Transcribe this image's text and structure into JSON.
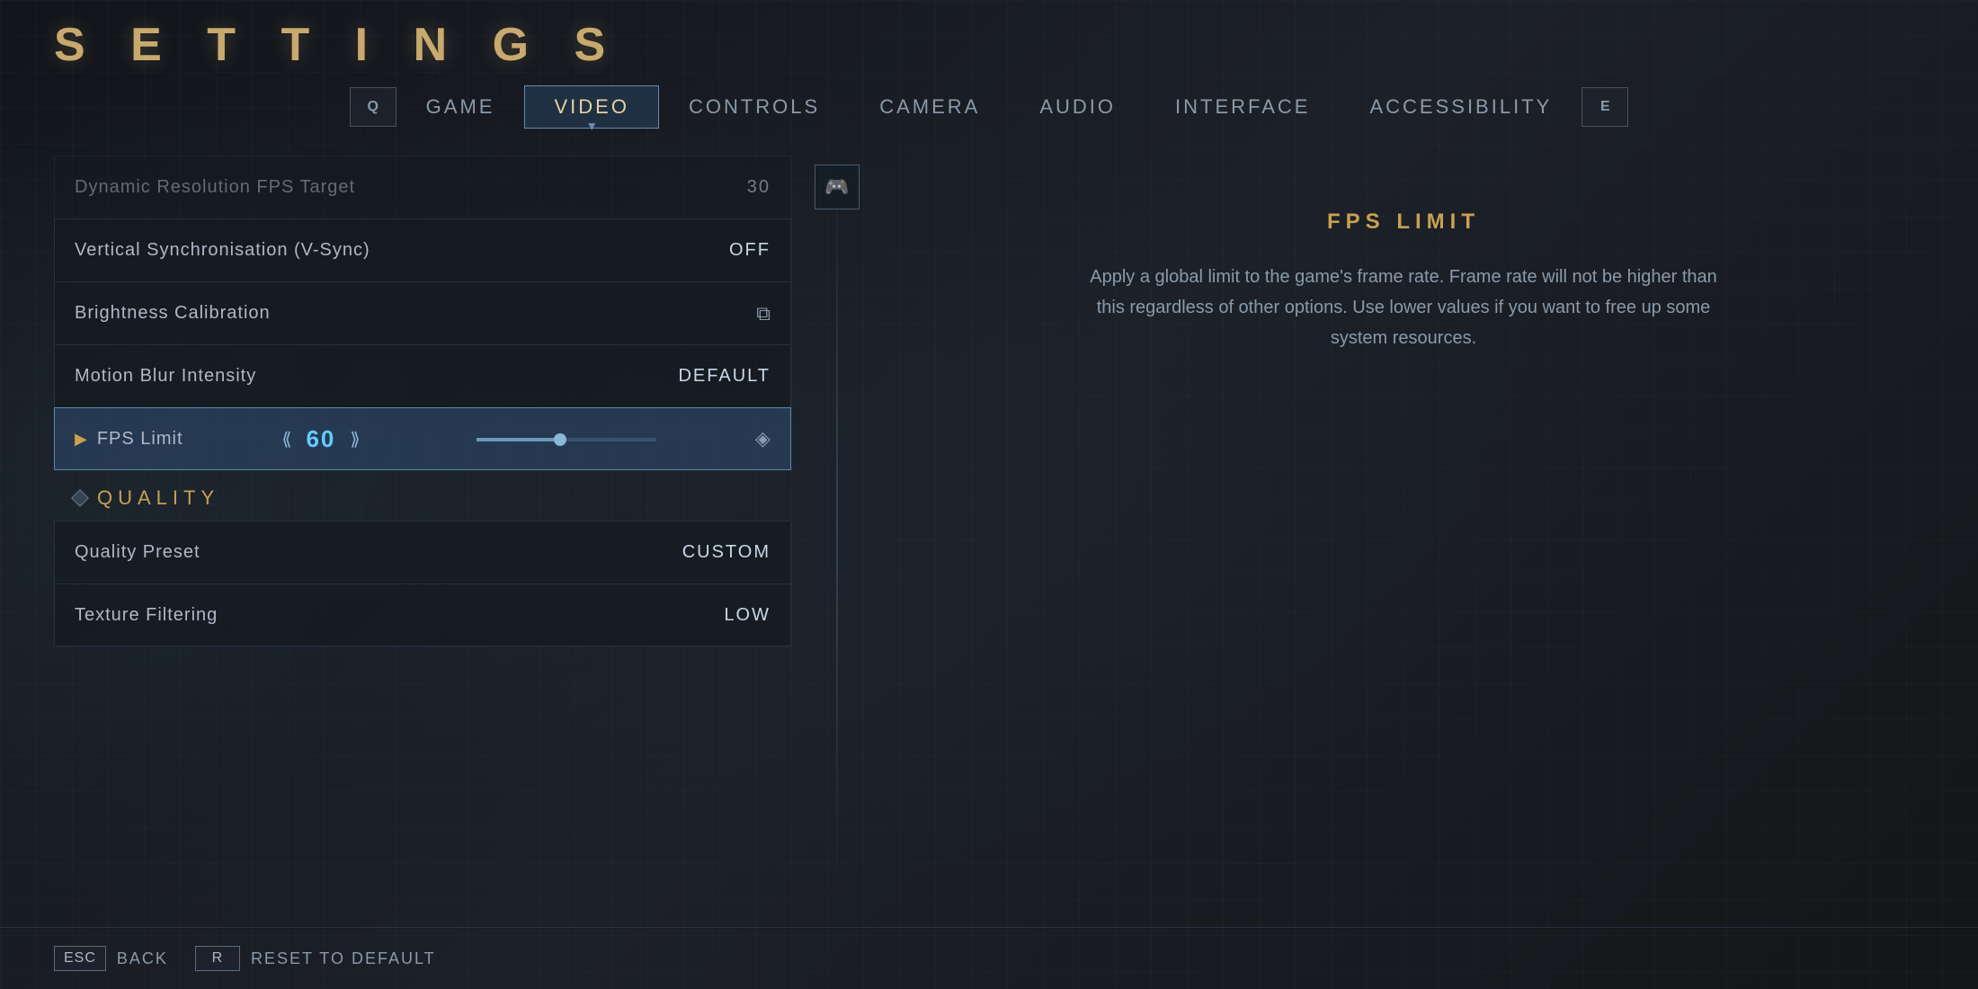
{
  "page": {
    "title": "S E T T I N G S"
  },
  "nav": {
    "left_icon": "Q",
    "right_icon": "E",
    "tabs": [
      {
        "id": "game",
        "label": "GAME",
        "active": false
      },
      {
        "id": "video",
        "label": "VIDEO",
        "active": true
      },
      {
        "id": "controls",
        "label": "CONTROLS",
        "active": false
      },
      {
        "id": "camera",
        "label": "CAMERA",
        "active": false
      },
      {
        "id": "audio",
        "label": "AUDIO",
        "active": false
      },
      {
        "id": "interface",
        "label": "INTERFACE",
        "active": false
      },
      {
        "id": "accessibility",
        "label": "ACCESSIBILITY",
        "active": false
      }
    ]
  },
  "settings": {
    "items": [
      {
        "id": "dynamic-resolution",
        "name": "Dynamic Resolution FPS Target",
        "value": "30",
        "dimmed": true
      },
      {
        "id": "vsync",
        "name": "Vertical Synchronisation (V-Sync)",
        "value": "OFF"
      },
      {
        "id": "brightness",
        "name": "Brightness Calibration",
        "value": "",
        "has_icon": true
      },
      {
        "id": "motion-blur",
        "name": "Motion Blur Intensity",
        "value": "DEFAULT"
      },
      {
        "id": "fps-limit",
        "name": "FPS Limit",
        "value": "60",
        "active": true,
        "has_slider": true
      }
    ],
    "quality_section": {
      "header": "QUALITY",
      "items": [
        {
          "id": "quality-preset",
          "name": "Quality Preset",
          "value": "CUSTOM"
        },
        {
          "id": "texture-filtering",
          "name": "Texture Filtering",
          "value": "LOW"
        }
      ]
    }
  },
  "info_panel": {
    "title": "FPS LIMIT",
    "description": "Apply a global limit to the game's frame rate. Frame rate will not be higher than this regardless of other options. Use lower values if you want to free up some system resources."
  },
  "bottom_bar": {
    "buttons": [
      {
        "key": "ESC",
        "label": "Back"
      },
      {
        "key": "R",
        "label": "Reset to Default"
      }
    ]
  }
}
